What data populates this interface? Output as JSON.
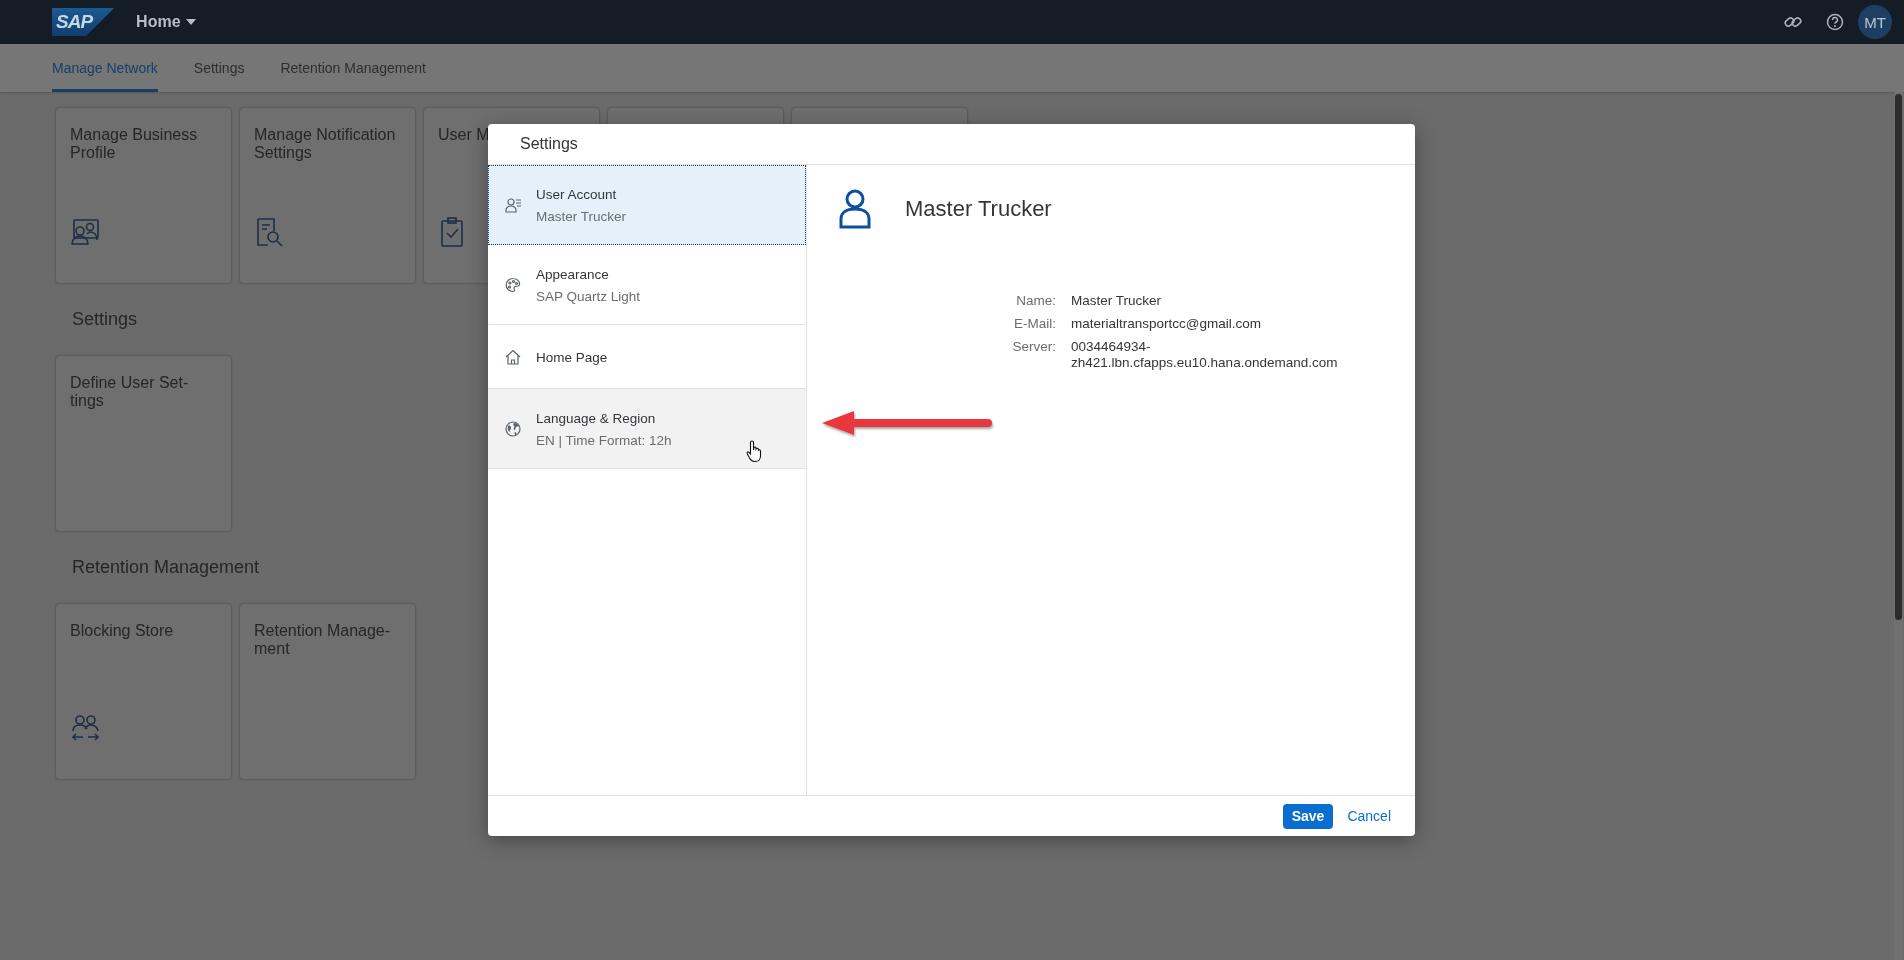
{
  "shell": {
    "logo": "SAP",
    "title": "Home",
    "avatar": "MT"
  },
  "tabs": [
    {
      "label": "Manage Network",
      "selected": true
    },
    {
      "label": "Settings",
      "selected": false
    },
    {
      "label": "Retention Management",
      "selected": false
    }
  ],
  "sections": [
    {
      "tiles": [
        {
          "title": "Manage Business Profile",
          "kind": "profile"
        },
        {
          "title": "Manage Notification Settings",
          "kind": "document-search"
        },
        {
          "title": "User M",
          "kind": "clipboard"
        },
        {
          "kind": "blank"
        },
        {
          "kind": "blank"
        }
      ]
    },
    {
      "heading": "Settings",
      "tiles": [
        {
          "title": "Define User Set-tings",
          "kind": "none"
        }
      ]
    },
    {
      "heading": "Retention Management",
      "tiles": [
        {
          "title": "Blocking Store",
          "kind": "people-exchange"
        },
        {
          "title": "Retention Manage-ment",
          "kind": "none"
        }
      ]
    }
  ],
  "dialog": {
    "title": "Settings",
    "items": [
      {
        "title": "User Account",
        "subtitle": "Master Trucker",
        "kind": "user",
        "selected": true,
        "hovered": false
      },
      {
        "title": "Appearance",
        "subtitle": "SAP Quartz Light",
        "kind": "palette",
        "selected": false,
        "hovered": false
      },
      {
        "title": "Home Page",
        "kind": "home",
        "selected": false,
        "hovered": false
      },
      {
        "title": "Language & Region",
        "subtitle": "EN | Time Format: 12h",
        "kind": "globe",
        "selected": false,
        "hovered": true
      }
    ],
    "detail": {
      "name": "Master Trucker",
      "fields": [
        {
          "label": "Name:",
          "value": "Master Trucker"
        },
        {
          "label": "E-Mail:",
          "value": "materialtransportcc@gmail.com"
        },
        {
          "label": "Server:",
          "value": "0034464934-zh421.lbn.cfapps.eu10.hana.ondemand.com"
        }
      ]
    },
    "buttons": [
      {
        "label": "Save",
        "kind": "primary"
      },
      {
        "label": "Cancel",
        "kind": "link"
      }
    ]
  }
}
